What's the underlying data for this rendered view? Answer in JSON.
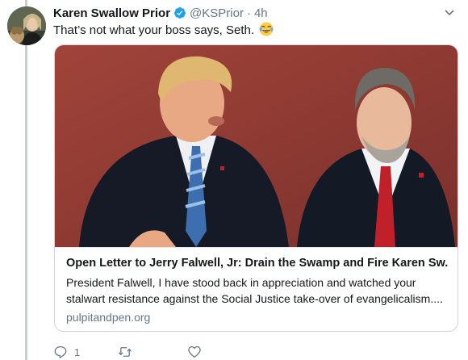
{
  "tweet": {
    "display_name": "Karen Swallow Prior",
    "verified_icon": "verified-badge-icon",
    "handle": "@KSPrior",
    "separator": "·",
    "timestamp": "4h",
    "text": "That’s not what your boss says, Seth.",
    "emoji": "face-with-tears-of-joy-icon"
  },
  "card": {
    "title": "Open Letter to Jerry Falwell, Jr: Drain the Swamp and Fire Karen Sw...",
    "description_line1": "President Falwell, I have stood back in appreciation and watched your",
    "description_line2": "stalwart resistance against the Social Justice take-over of evangelicalism....",
    "domain": "pulpitandpen.org"
  },
  "actions": {
    "reply_count": "1",
    "retweet_count": "",
    "like_count": ""
  },
  "colors": {
    "text_primary": "#14171a",
    "text_secondary": "#657786",
    "verified_blue": "#1da1f2",
    "border": "#ccd6dd",
    "thread_line": "#c4cfd6"
  }
}
